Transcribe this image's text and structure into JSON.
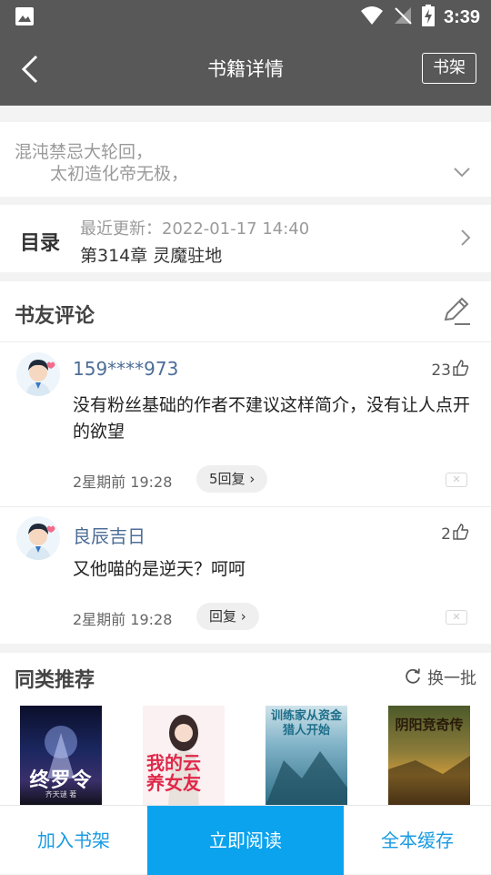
{
  "status_bar": {
    "time": "3:39"
  },
  "app_bar": {
    "title": "书籍详情",
    "shelf_button": "书架"
  },
  "intro": {
    "line1": "混沌禁忌大轮回，",
    "line2": "太初造化帝无极，"
  },
  "toc": {
    "label": "目录",
    "updated": "最近更新：2022-01-17 14:40",
    "chapter": "第314章 灵魔驻地"
  },
  "comments": {
    "heading": "书友评论",
    "items": [
      {
        "name": "159****973",
        "likes": "23",
        "text": "没有粉丝基础的作者不建议这样简介，没有让人点开的欲望",
        "time": "2星期前  19:28",
        "reply": "5回复"
      },
      {
        "name": "良辰吉日",
        "likes": "2",
        "text": "又他喵的是逆天？呵呵",
        "time": "2星期前  19:28",
        "reply": "回复"
      }
    ]
  },
  "recommend": {
    "heading": "同类推荐",
    "refresh": "换一批",
    "covers": [
      {
        "text": "终罗令",
        "author": "齐天谜 著"
      },
      {
        "text": "我的云养女友"
      },
      {
        "text": "训练家从资金猎人开始"
      },
      {
        "text": "阴阳竞奇传"
      }
    ]
  },
  "bottom_bar": {
    "add": "加入书架",
    "read": "立即阅读",
    "cache": "全本缓存"
  },
  "colors": {
    "header": "#585858",
    "accent": "#0ba3ee",
    "link": "#1a9be3",
    "username": "#4d6e97"
  }
}
